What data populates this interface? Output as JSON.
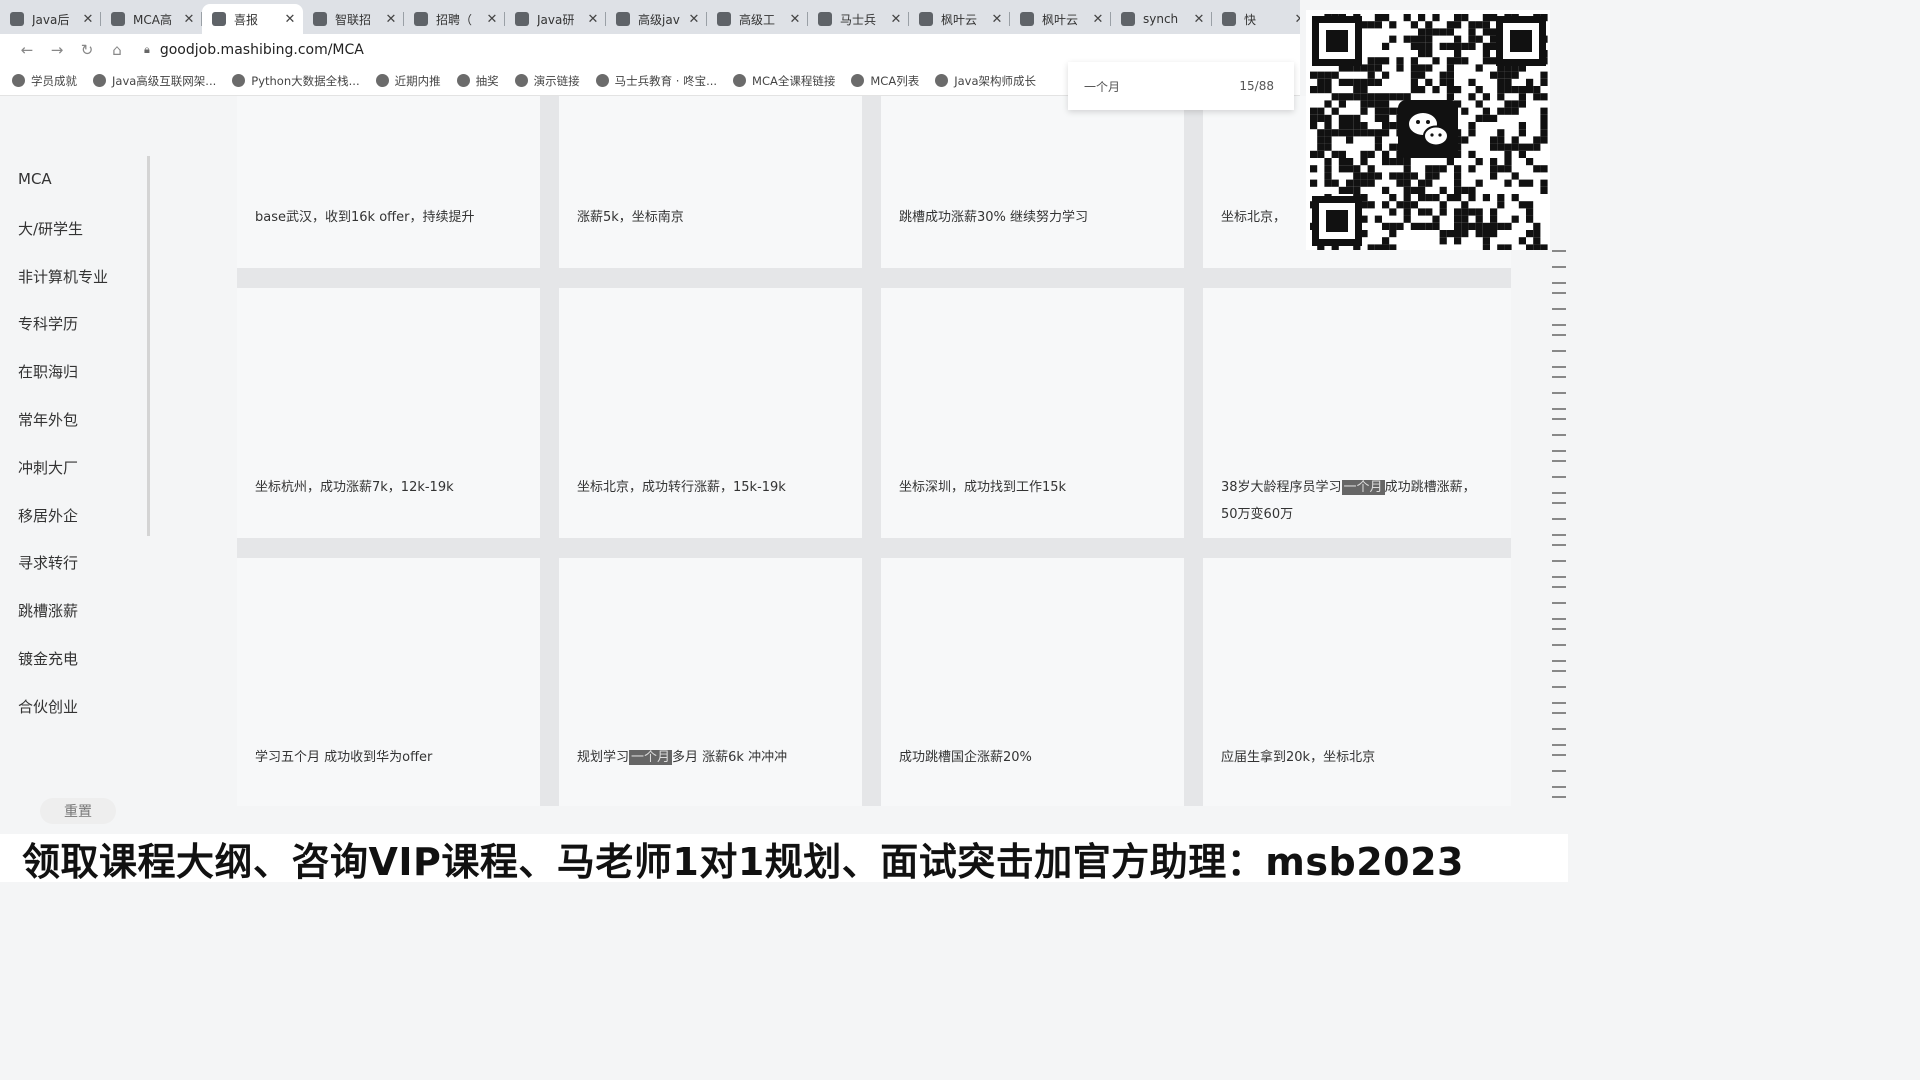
{
  "tabs": [
    {
      "title": "Java后",
      "active": false
    },
    {
      "title": "MCA高",
      "active": false
    },
    {
      "title": "喜报",
      "active": true
    },
    {
      "title": "智联招",
      "active": false
    },
    {
      "title": "招聘（",
      "active": false
    },
    {
      "title": "Java研",
      "active": false
    },
    {
      "title": "高级jav",
      "active": false
    },
    {
      "title": "高级工",
      "active": false
    },
    {
      "title": "马士兵",
      "active": false
    },
    {
      "title": "枫叶云",
      "active": false
    },
    {
      "title": "枫叶云",
      "active": false
    },
    {
      "title": "synch",
      "active": false
    },
    {
      "title": "快",
      "active": false
    }
  ],
  "address": {
    "url": "goodjob.mashibing.com/MCA"
  },
  "bookmarks": [
    "学员成就",
    "Java高级互联网架...",
    "Python大数据全栈...",
    "近期内推",
    "抽奖",
    "演示链接",
    "马士兵教育 · 咚宝...",
    "MCA全课程链接",
    "MCA列表",
    "Java架构师成长"
  ],
  "dropdown": {
    "value": "一个月",
    "count": "15/88"
  },
  "sidebar": {
    "items": [
      "MCA",
      "大/研学生",
      "非计算机专业",
      "专科学历",
      "在职海归",
      "常年外包",
      "冲刺大厂",
      "移居外企",
      "寻求转行",
      "跳槽涨薪",
      "镀金充电",
      "合伙创业"
    ],
    "reset": "重置"
  },
  "cards": {
    "row1": [
      "base武汉，收到16k offer，持续提升",
      "涨薪5k，坐标南京",
      "跳槽成功涨薪30% 继续努力学习",
      "坐标北京，"
    ],
    "row2": [
      "坐标杭州，成功涨薪7k，12k-19k",
      "坐标北京，成功转行涨薪，15k-19k",
      "坐标深圳，成功找到工作15k"
    ],
    "row2_last": {
      "pre": "38岁大龄程序员学习",
      "hl": "一个月",
      "post": "成功跳槽涨薪，",
      "line2": "50万变60万"
    },
    "row3_0": "学习五个月 成功收到华为offer",
    "row3_1": {
      "pre": "规划学习",
      "hl": "一个月",
      "post": "多月 涨薪6k 冲冲冲"
    },
    "row3_2": "成功跳槽国企涨薪20%",
    "row3_3": "应届生拿到20k，坐标北京"
  },
  "banner": "领取课程大纲、咨询VIP课程、马老师1对1规划、面试突击加官方助理：msb2023"
}
